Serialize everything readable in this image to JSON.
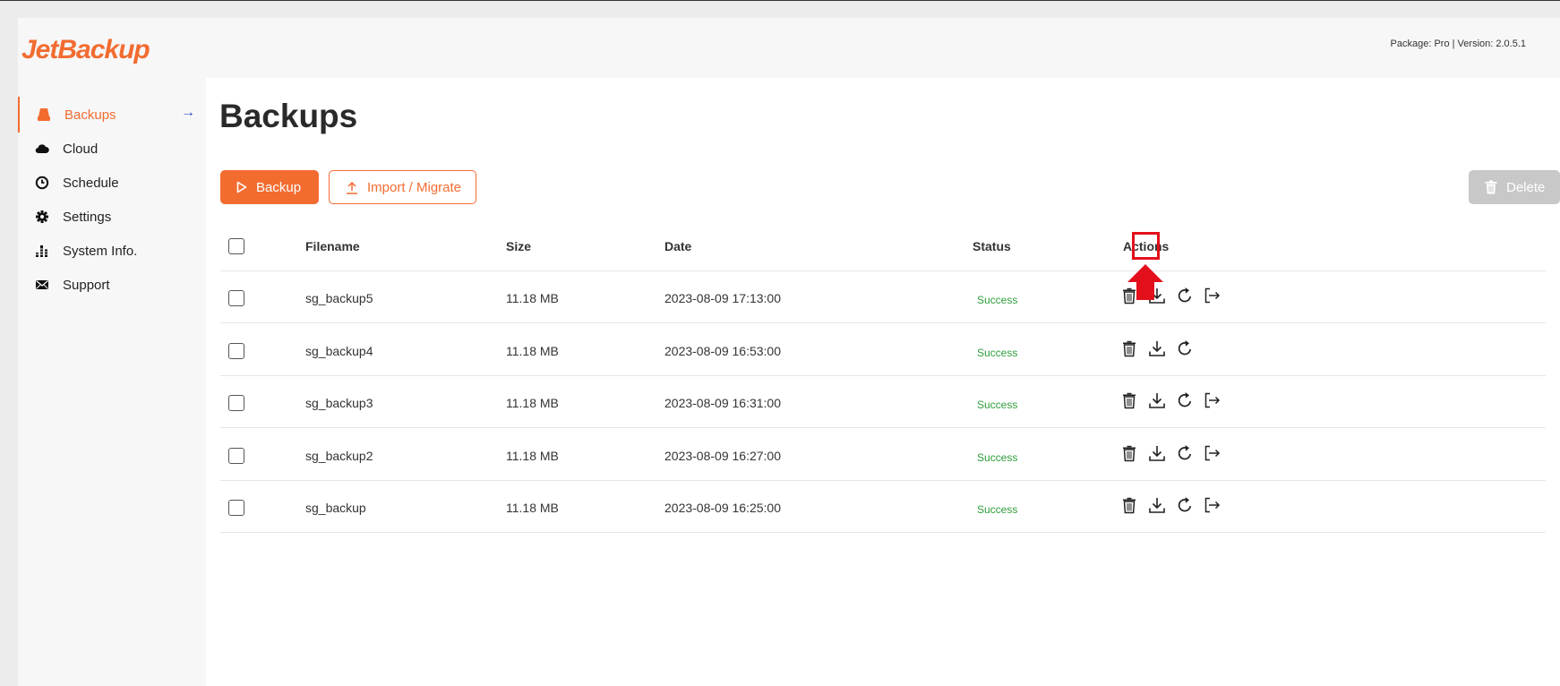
{
  "header": {
    "logo_text": "JetBackup",
    "package_info": "Package: Pro | Version: 2.0.5.1"
  },
  "sidebar": {
    "items": [
      {
        "label": "Backups",
        "icon": "drive-icon",
        "active": true
      },
      {
        "label": "Cloud",
        "icon": "cloud-icon"
      },
      {
        "label": "Schedule",
        "icon": "clock-icon"
      },
      {
        "label": "Settings",
        "icon": "gear-icon"
      },
      {
        "label": "System Info.",
        "icon": "bars-icon"
      },
      {
        "label": "Support",
        "icon": "envelope-icon"
      }
    ],
    "active_arrow": "→"
  },
  "main": {
    "title": "Backups",
    "buttons": {
      "backup": "Backup",
      "import_migrate": "Import / Migrate",
      "delete": "Delete"
    },
    "table": {
      "columns": [
        "Filename",
        "Size",
        "Date",
        "Status",
        "Actions"
      ],
      "rows": [
        {
          "filename": "sg_backup5",
          "size": "11.18 MB",
          "date": "2023-08-09 17:13:00",
          "status": "Success"
        },
        {
          "filename": "sg_backup4",
          "size": "11.18 MB",
          "date": "2023-08-09 16:53:00",
          "status": "Success"
        },
        {
          "filename": "sg_backup3",
          "size": "11.18 MB",
          "date": "2023-08-09 16:31:00",
          "status": "Success"
        },
        {
          "filename": "sg_backup2",
          "size": "11.18 MB",
          "date": "2023-08-09 16:27:00",
          "status": "Success"
        },
        {
          "filename": "sg_backup",
          "size": "11.18 MB",
          "date": "2023-08-09 16:25:00",
          "status": "Success"
        }
      ]
    }
  },
  "colors": {
    "accent": "#f26c30",
    "success": "#2e9e3c",
    "highlight": "#e3101c",
    "disabled": "#c8c8c8"
  }
}
